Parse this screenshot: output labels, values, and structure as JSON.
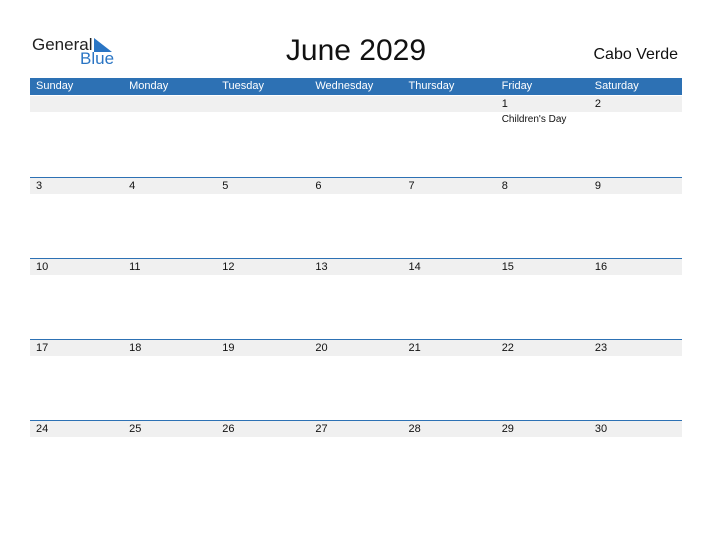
{
  "logo": {
    "general": "General",
    "blue": "Blue"
  },
  "title": "June 2029",
  "country": "Cabo Verde",
  "days": [
    "Sunday",
    "Monday",
    "Tuesday",
    "Wednesday",
    "Thursday",
    "Friday",
    "Saturday"
  ],
  "weeks": [
    [
      {
        "d": ""
      },
      {
        "d": ""
      },
      {
        "d": ""
      },
      {
        "d": ""
      },
      {
        "d": ""
      },
      {
        "d": "1",
        "e": "Children's Day"
      },
      {
        "d": "2"
      }
    ],
    [
      {
        "d": "3"
      },
      {
        "d": "4"
      },
      {
        "d": "5"
      },
      {
        "d": "6"
      },
      {
        "d": "7"
      },
      {
        "d": "8"
      },
      {
        "d": "9"
      }
    ],
    [
      {
        "d": "10"
      },
      {
        "d": "11"
      },
      {
        "d": "12"
      },
      {
        "d": "13"
      },
      {
        "d": "14"
      },
      {
        "d": "15"
      },
      {
        "d": "16"
      }
    ],
    [
      {
        "d": "17"
      },
      {
        "d": "18"
      },
      {
        "d": "19"
      },
      {
        "d": "20"
      },
      {
        "d": "21"
      },
      {
        "d": "22"
      },
      {
        "d": "23"
      }
    ],
    [
      {
        "d": "24"
      },
      {
        "d": "25"
      },
      {
        "d": "26"
      },
      {
        "d": "27"
      },
      {
        "d": "28"
      },
      {
        "d": "29"
      },
      {
        "d": "30"
      }
    ]
  ]
}
